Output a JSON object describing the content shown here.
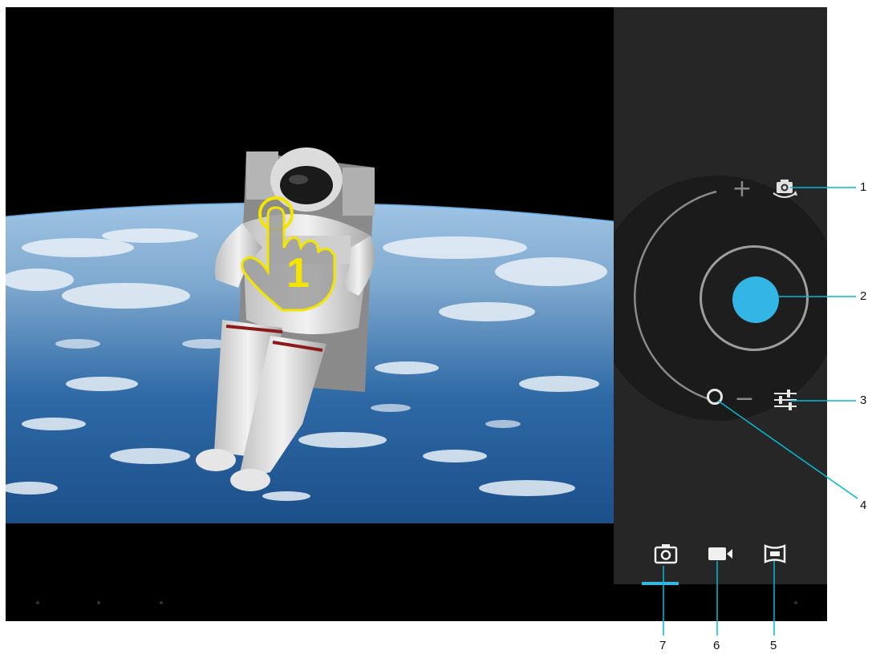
{
  "viewfinder": {
    "scene": "astronaut-over-earth",
    "tap_hint_number": "1"
  },
  "controls": {
    "zoom_in_symbol": "+",
    "zoom_out_symbol": "−",
    "switch_camera_icon": "switch-camera-icon",
    "shutter_color": "#33b5e5",
    "settings_icon": "settings-sliders-icon",
    "zoom_handle_icon": "zoom-handle-icon"
  },
  "modes": [
    {
      "name": "camera",
      "icon": "camera-icon",
      "selected": true
    },
    {
      "name": "video",
      "icon": "video-camera-icon",
      "selected": false
    },
    {
      "name": "panorama",
      "icon": "panorama-icon",
      "selected": false
    }
  ],
  "callouts": {
    "one": "1",
    "two": "2",
    "three": "3",
    "four": "4",
    "five": "5",
    "six": "6",
    "seven": "7"
  },
  "colors": {
    "accent": "#33b5e5",
    "callout_line": "#00bcd4",
    "panel_bg": "#262626",
    "hint_yellow": "#f4e500"
  }
}
